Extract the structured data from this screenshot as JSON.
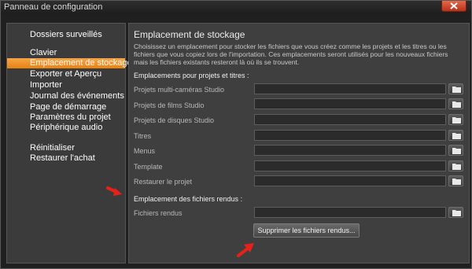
{
  "window": {
    "title": "Panneau de configuration"
  },
  "sidebar": {
    "items": [
      {
        "label": "Dossiers surveillés",
        "active": false
      },
      {
        "label": "Clavier",
        "active": false
      },
      {
        "label": "Emplacement de stockage",
        "active": true
      },
      {
        "label": "Exporter et Aperçu",
        "active": false
      },
      {
        "label": "Importer",
        "active": false
      },
      {
        "label": "Journal des événements",
        "active": false
      },
      {
        "label": "Page de démarrage",
        "active": false
      },
      {
        "label": "Paramètres du projet",
        "active": false
      },
      {
        "label": "Périphérique audio",
        "active": false
      },
      {
        "label": "Réinitialiser",
        "active": false
      },
      {
        "label": "Restaurer l'achat",
        "active": false
      }
    ]
  },
  "content": {
    "title": "Emplacement de stockage",
    "description": "Choisissez un emplacement pour stocker les fichiers que vous créez comme les projets et les titres ou les fichiers que vous copiez lors de l'importation. Ces emplacements seront utilisés pour les nouveaux fichiers mais les fichiers existants resteront là où ils se trouvent.",
    "projects_section": {
      "heading": "Emplacements pour projets et titres :",
      "rows": [
        {
          "label": "Projets multi-caméras Studio",
          "value": ""
        },
        {
          "label": "Projets de films Studio",
          "value": ""
        },
        {
          "label": "Projets de disques Studio",
          "value": ""
        },
        {
          "label": "Titres",
          "value": ""
        },
        {
          "label": "Menus",
          "value": ""
        },
        {
          "label": "Template",
          "value": ""
        },
        {
          "label": "Restaurer le projet",
          "value": ""
        }
      ]
    },
    "rendered_section": {
      "heading": "Emplacement des fichiers rendus :",
      "rows": [
        {
          "label": "Fichiers rendus",
          "value": ""
        }
      ],
      "delete_button": "Supprimer les fichiers rendus..."
    }
  },
  "colors": {
    "accent": "#f39a2e",
    "annotation_arrow": "#e8201a",
    "close_button": "#d24a2c"
  },
  "icons": {
    "close": "close-icon",
    "folder": "folder-icon",
    "annotation": "red-arrow-icon"
  }
}
